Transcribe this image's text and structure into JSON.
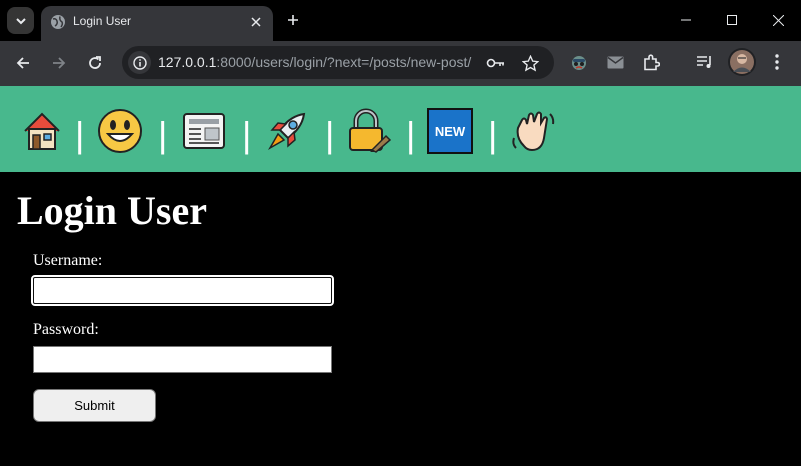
{
  "browser": {
    "tab_title": "Login User",
    "url_host": "127.0.0.1",
    "url_rest": ":8000/users/login/?next=/posts/new-post/"
  },
  "nav": {
    "items": [
      "home-icon",
      "smiley-icon",
      "newspaper-icon",
      "rocket-icon",
      "locked-with-pen-icon",
      "new-badge-icon",
      "waving-hand-icon"
    ],
    "separator": "|",
    "new_badge_text": "NEW"
  },
  "page": {
    "title": "Login User",
    "username_label": "Username:",
    "username_value": "",
    "password_label": "Password:",
    "password_value": "",
    "submit_label": "Submit"
  },
  "colors": {
    "navbar_bg": "#48b88d",
    "page_bg": "#000000",
    "toolbar_bg": "#35363a",
    "tab_bg": "#35363a"
  }
}
